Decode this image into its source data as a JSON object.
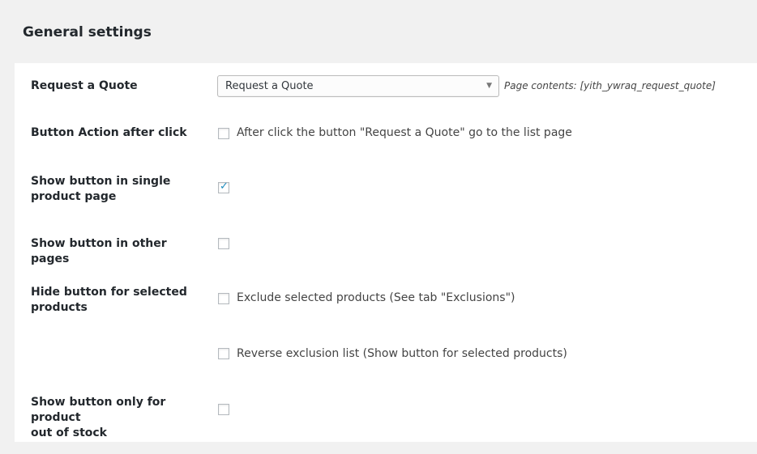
{
  "section": {
    "title": "General settings"
  },
  "rows": {
    "request_quote": {
      "label": "Request a Quote",
      "select_value": "Request a Quote",
      "description": "Page contents: [yith_ywraq_request_quote]"
    },
    "button_action": {
      "label": "Button Action after click",
      "checkbox_label": "After click the button \"Request a Quote\" go to the list page",
      "checked": false
    },
    "single_product": {
      "label_line1": "Show button in single",
      "label_line2": "product page",
      "checked": true
    },
    "other_pages": {
      "label": "Show button in other pages",
      "checked": false
    },
    "hide_selected": {
      "label_line1": "Hide button for selected",
      "label_line2": "products",
      "exclude_label": "Exclude selected products (See tab \"Exclusions\")",
      "exclude_checked": false,
      "reverse_label": "Reverse exclusion list (Show button for selected products)",
      "reverse_checked": false
    },
    "out_of_stock": {
      "label_line1": "Show button only for product",
      "label_line2": "out of stock",
      "checked": false
    }
  },
  "colors": {
    "page_bg": "#f1f1f1",
    "panel_bg": "#ffffff",
    "check_color": "#1e8cbe"
  }
}
